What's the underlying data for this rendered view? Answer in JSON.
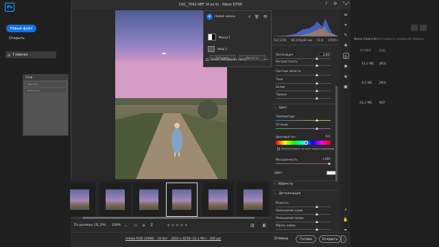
{
  "app": {
    "logo": "Ps"
  },
  "home": {
    "new_file": "Новый файл",
    "open": "Открыть",
    "home_label": "Главная",
    "filter_label": "Фильтровать",
    "filter_note": "Фильтровать недавние файлы",
    "col_size": "РАЗМЕР",
    "col_type": "ВИД",
    "rows": [
      {
        "size": "12,2 МБ",
        "type": "JPEG"
      },
      {
        "size": "9,5 МБ",
        "type": "JPEG"
      },
      {
        "size": "24,2 МБ",
        "type": "NEF"
      }
    ]
  },
  "layers": {
    "title": "Слои",
    "fields": [
      "Обычные",
      "Закрепить:"
    ]
  },
  "dialog": {
    "title": "DSC_7062.NEF (4 из 6)  -  Nikon D700"
  },
  "mask": {
    "new_mask": "Новая маска",
    "mask1": "Маска 1",
    "sky1": "Небо 1",
    "add": "Добавить",
    "subtract": "Вычесть",
    "show_overlay": "Показ. наложение (авто)"
  },
  "meta": {
    "iso": "ISO 1250",
    "lens": "80-200@92 мм",
    "aperture": "f/2,8",
    "shutter": "1/500 с"
  },
  "sliders": {
    "exposure": {
      "label": "Экспозиция",
      "value": "0,00"
    },
    "contrast": {
      "label": "Контрастность",
      "value": "0"
    },
    "highlights": {
      "label": "Светлые области",
      "value": "0"
    },
    "shadows": {
      "label": "Тени",
      "value": "0"
    },
    "whites": {
      "label": "Белые",
      "value": "0"
    },
    "blacks": {
      "label": "Черные",
      "value": "0"
    },
    "temp": {
      "label": "Температура",
      "value": "0"
    },
    "tint": {
      "label": "Оттенок",
      "value": "0"
    },
    "hue": {
      "label": "Цветовой тон",
      "value": "0,0"
    },
    "saturation": {
      "label": "Насыщенность",
      "value": "+100"
    },
    "sharpness": {
      "label": "Резкость",
      "value": "0"
    },
    "noise_luma": {
      "label": "Уменьшение шума",
      "value": "0"
    },
    "moire": {
      "label": "Уменьшение муара",
      "value": "0"
    },
    "defringe": {
      "label": "Убрать кайму",
      "value": "0"
    }
  },
  "sections": {
    "color": "Цвет",
    "effects": "Эффекты",
    "detail": "Детализация",
    "color_row": "Цвет"
  },
  "fine_adjust": "Использовать точное редактирование",
  "status": {
    "zoom_label": "По размеру (31,2%)",
    "zoom_pct": "100%",
    "stars": "★★★★★"
  },
  "footer": {
    "file_info": "Adobe RGB (1998) - 16 бит - 2833 x 4258 (12,1 Мп) - 300 ppi",
    "cancel": "Отмена",
    "done": "Готово",
    "open": "Открыть"
  }
}
